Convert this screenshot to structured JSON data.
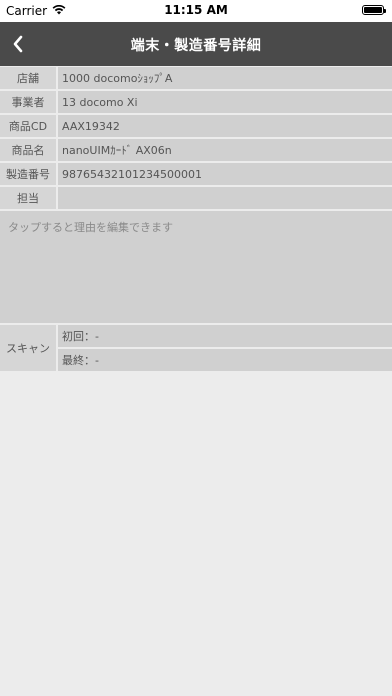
{
  "status_bar": {
    "carrier": "Carrier",
    "time": "11:15 AM"
  },
  "navbar": {
    "title": "端末・製造番号詳細",
    "back_icon": "chevron-left-icon"
  },
  "details": [
    {
      "label": "店舗",
      "value": "1000 docomoｼｮｯﾌﾟA"
    },
    {
      "label": "事業者",
      "value": "13 docomo Xi"
    },
    {
      "label": "商品CD",
      "value": "AAX19342"
    },
    {
      "label": "商品名",
      "value": "nanoUIMｶｰﾄﾞ AX06n"
    },
    {
      "label": "製造番号",
      "value": "98765432101234500001"
    },
    {
      "label": "担当",
      "value": ""
    }
  ],
  "memo": {
    "placeholder": "タップすると理由を編集できます"
  },
  "scan": {
    "label": "スキャン",
    "first": "初回：-",
    "last": "最終：-"
  }
}
